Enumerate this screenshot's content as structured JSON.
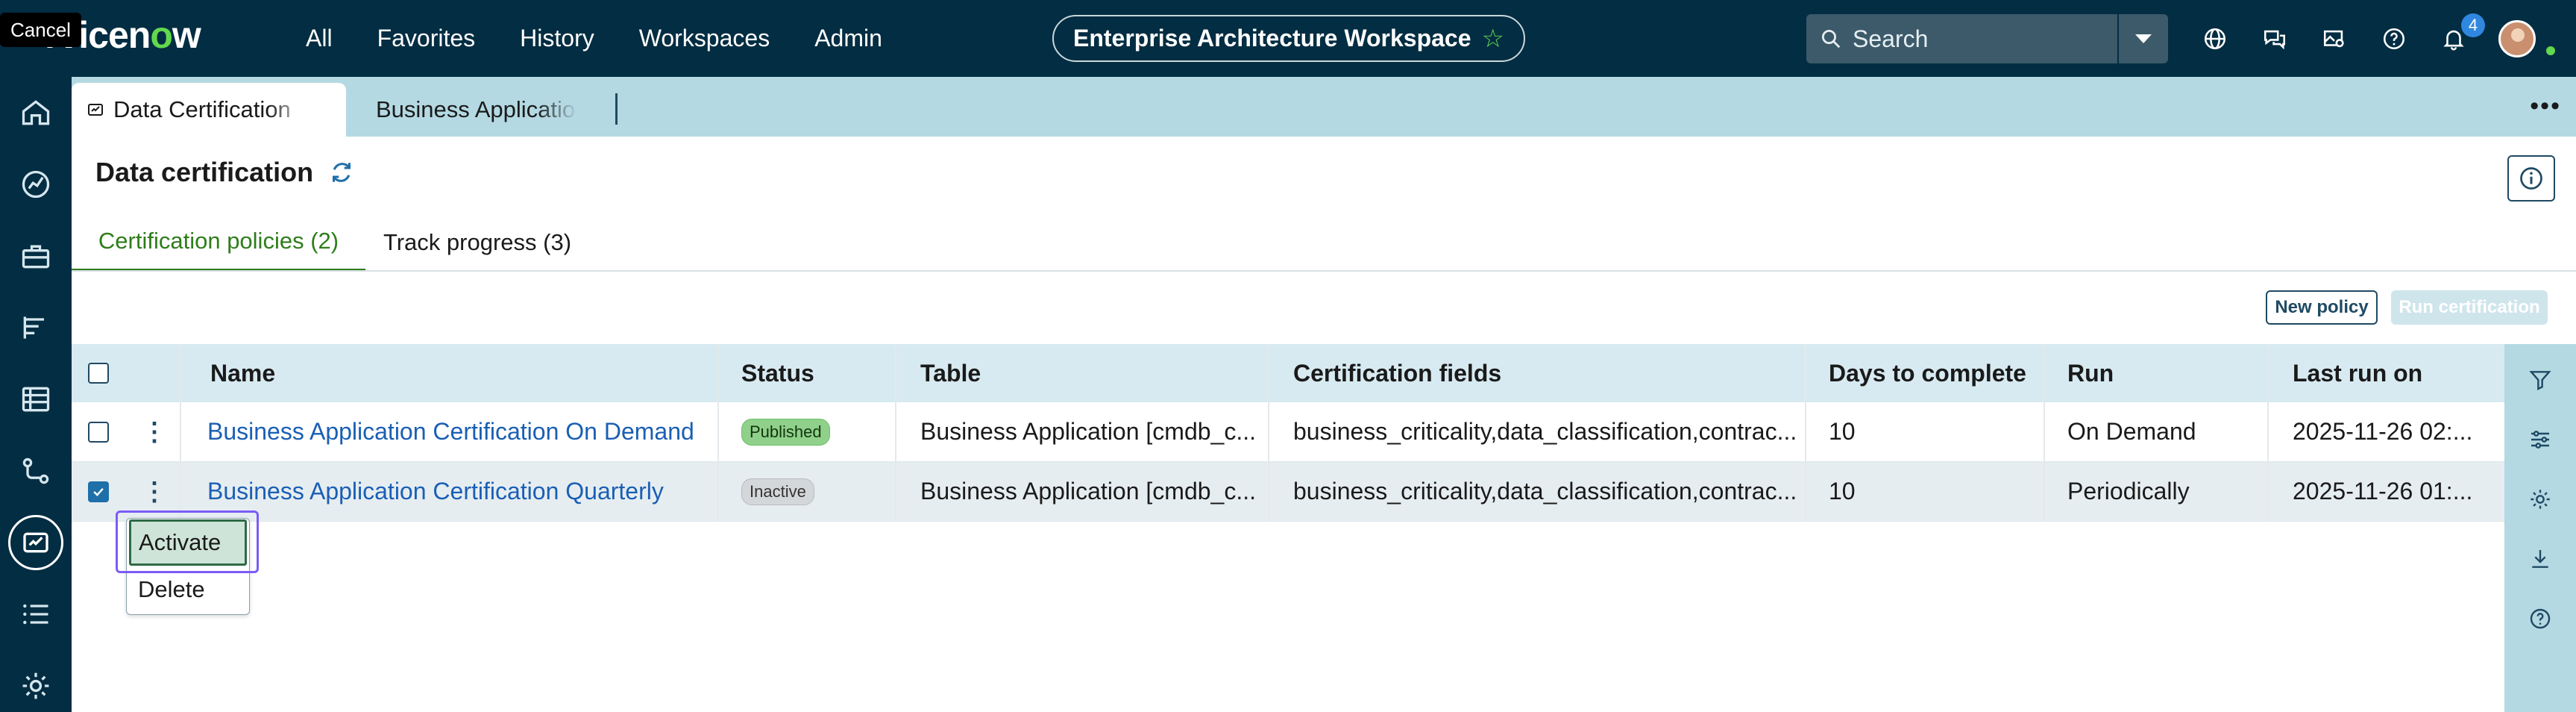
{
  "tooltip": "Cancel",
  "brand": {
    "logo_prefix": "rvicen",
    "logo_o": "o",
    "logo_suffix": "w"
  },
  "nav": [
    "All",
    "Favorites",
    "History",
    "Workspaces",
    "Admin"
  ],
  "workspace": {
    "title": "Enterprise Architecture Workspace"
  },
  "search": {
    "placeholder": "Search"
  },
  "notifications": {
    "count": "4"
  },
  "tabs": [
    {
      "label": "Data Certification"
    },
    {
      "label": "Business Application"
    }
  ],
  "page": {
    "title": "Data certification",
    "subtabs": [
      {
        "label": "Certification policies (2)"
      },
      {
        "label": "Track progress (3)"
      }
    ],
    "buttons": {
      "new_policy": "New policy",
      "run_certification": "Run certification"
    }
  },
  "table": {
    "columns": [
      "Name",
      "Status",
      "Table",
      "Certification fields",
      "Days to complete",
      "Run",
      "Last run on"
    ],
    "rows": [
      {
        "checked": false,
        "name": "Business Application Certification On Demand",
        "status": "Published",
        "table": "Business Application [cmdb_c...",
        "fields": "business_criticality,data_classification,contrac...",
        "days": "10",
        "run": "On Demand",
        "last_run": "2025-11-26 02:..."
      },
      {
        "checked": true,
        "name": "Business Application Certification Quarterly",
        "status": "Inactive",
        "table": "Business Application [cmdb_c...",
        "fields": "business_criticality,data_classification,contrac...",
        "days": "10",
        "run": "Periodically",
        "last_run": "2025-11-26 01:..."
      }
    ]
  },
  "context_menu": {
    "activate": "Activate",
    "delete": "Delete"
  },
  "colors": {
    "nav_bg": "#032d42",
    "accent_green": "#2e7d1a",
    "link": "#1a5fb4",
    "focus_ring": "#7b5cf5"
  }
}
